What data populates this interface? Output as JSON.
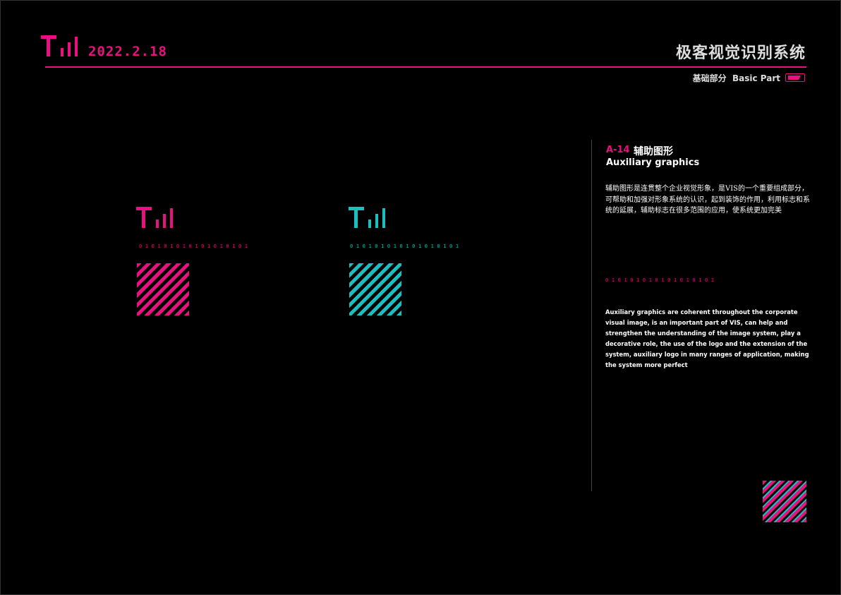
{
  "header": {
    "date": "2022.2.18",
    "title": "极客视觉识别系统",
    "section": "基础部分  Basic Part"
  },
  "colors": {
    "pink": "#e8117f",
    "cyan": "#1cbfc0"
  },
  "panel": {
    "code": "A-14",
    "title_cn": "辅助图形",
    "title_en": "Auxiliary graphics",
    "desc_cn": "辅助图形是连贯整个企业视觉形象，是VIS的一个重要组成部分，可帮助和加强对形象系统的认识，起到装饰的作用，利用标志和系统的延展，辅助标志在很多范围的应用，使系统更加完美",
    "binary": "010101010101010101",
    "desc_en": "Auxiliary graphics are coherent throughout the corporate visual image, is an important part of VIS, can help and strengthen the understanding of the image system, play a decorative role, the use of the logo and the extension of the system, auxiliary logo in many ranges of application, making the system more perfect"
  },
  "samples": [
    {
      "binary": "010101010101010101"
    },
    {
      "binary": "010101010101010101"
    }
  ]
}
